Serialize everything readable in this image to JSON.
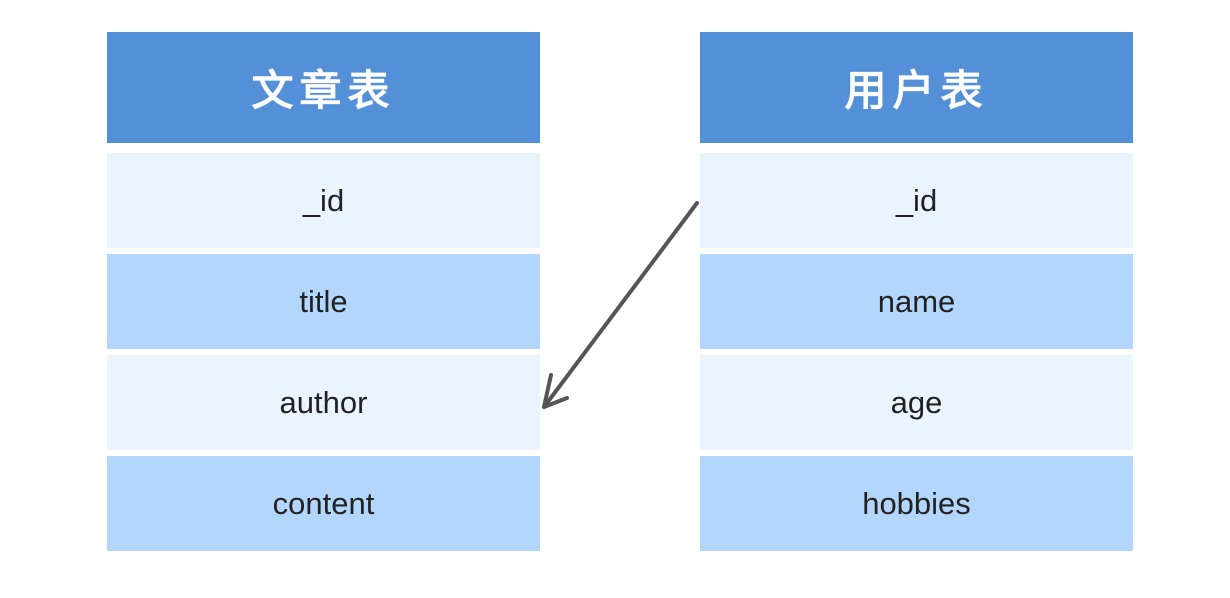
{
  "articles_table": {
    "title": "文章表",
    "fields": [
      "_id",
      "title",
      "author",
      "content"
    ]
  },
  "users_table": {
    "title": "用户表",
    "fields": [
      "_id",
      "name",
      "age",
      "hobbies"
    ]
  },
  "relation": {
    "from": "users_table._id",
    "to": "articles_table.author",
    "color": "#555555"
  },
  "colors": {
    "header": "#5490d8",
    "row_light": "#eaf4ff",
    "row_dark": "#b3d7fc"
  }
}
